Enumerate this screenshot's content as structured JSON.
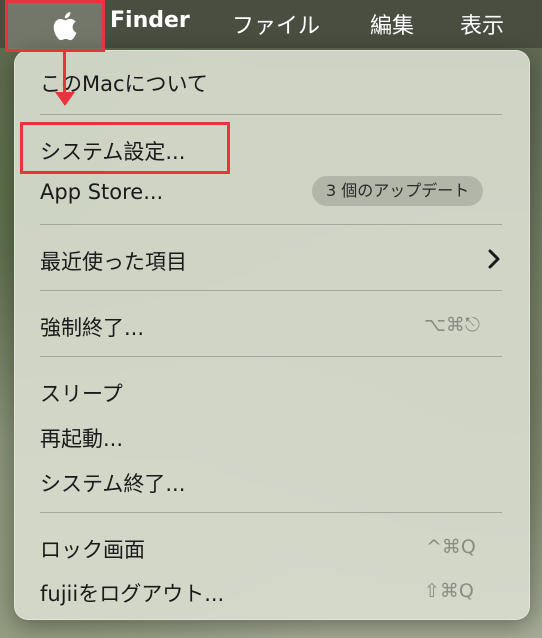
{
  "menubar": {
    "apple_icon": "apple-logo-icon",
    "finder": "Finder",
    "file": "ファイル",
    "edit": "編集",
    "view": "表示"
  },
  "menu": {
    "about": "このMacについて",
    "settings": "システム設定...",
    "appstore": "App Store...",
    "appstore_badge": "3 個のアップデート",
    "recent": "最近使った項目",
    "force_quit": "強制終了...",
    "force_quit_shortcut": "⌥⌘⎋",
    "sleep": "スリープ",
    "restart": "再起動...",
    "shutdown": "システム終了...",
    "lock": "ロック画面",
    "lock_shortcut": "^⌘Q",
    "logout": "fujiiをログアウト...",
    "logout_shortcut": "⇧⌘Q"
  },
  "colors": {
    "annotation": "#e8343d",
    "menu_bg": "#d7dcce",
    "menubar_bg": "#484c40"
  }
}
